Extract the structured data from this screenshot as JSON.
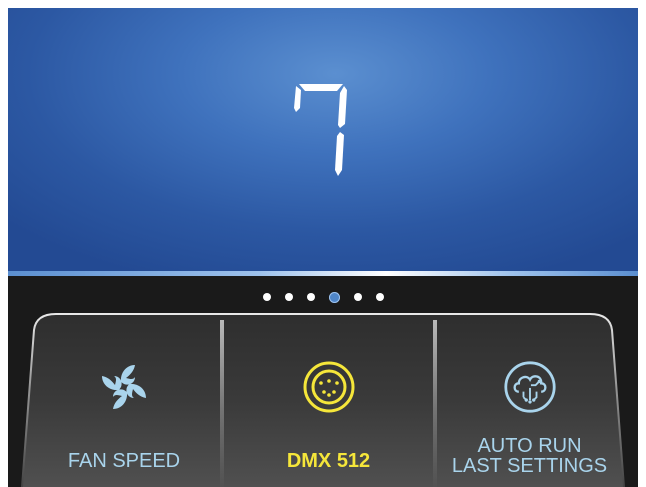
{
  "display": {
    "value": "7"
  },
  "pager": {
    "page_count": 6,
    "active_index": 3
  },
  "tiles": [
    {
      "label": "FAN SPEED",
      "icon": "fan-icon",
      "selected": false
    },
    {
      "label": "DMX 512",
      "icon": "dmx-connector-icon",
      "selected": true
    },
    {
      "label_line1": "AUTO RUN",
      "label_line2": "LAST SETTINGS",
      "icon": "cloud-circuit-icon",
      "selected": false
    }
  ],
  "colors": {
    "screen_blue": "#3f72bd",
    "accent_yellow": "#f5e63a",
    "label_cyan": "#a9d4ec",
    "background": "#1a1a1a"
  }
}
